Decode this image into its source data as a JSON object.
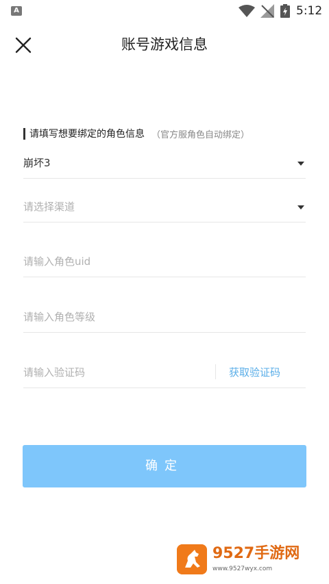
{
  "status_bar": {
    "app_icon_letter": "A",
    "time": "5:12"
  },
  "header": {
    "title": "账号游戏信息"
  },
  "form": {
    "section_label": "请填写想要绑定的角色信息",
    "section_note": "（官方服角色自动绑定）",
    "game": {
      "value": "崩坏3"
    },
    "channel": {
      "placeholder": "请选择渠道"
    },
    "uid": {
      "placeholder": "请输入角色uid"
    },
    "level": {
      "placeholder": "请输入角色等级"
    },
    "code": {
      "placeholder": "请输入验证码",
      "action_label": "获取验证码"
    },
    "confirm_label": "确定"
  },
  "watermark": {
    "brand": "9527手游网",
    "url": "www.9527wyx.com"
  },
  "colors": {
    "accent": "#7ec6fb",
    "link": "#5aaee8",
    "watermark": "#f07a1a"
  }
}
